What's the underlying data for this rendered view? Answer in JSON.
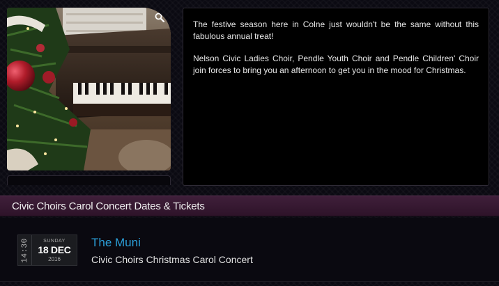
{
  "description": {
    "paragraph_1": "The festive season here in Colne just wouldn't be the same without this fabulous annual treat!",
    "paragraph_2": "Nelson Civic Ladies Choir, Pendle Youth Choir and Pendle Children' Choir join forces to bring you an afternoon to get you in the mood for Christmas."
  },
  "image": {
    "zoom_icon": "magnifier-icon"
  },
  "section": {
    "title": "Civic Choirs Carol Concert Dates & Tickets"
  },
  "event": {
    "time": "14:30",
    "weekday": "SUNDAY",
    "date": "18 DEC",
    "year": "2016",
    "venue": "The Muni",
    "title": "Civic Choirs Christmas Carol Concert"
  },
  "colors": {
    "link": "#2b9fd9",
    "header_bg": "#3f1f3a",
    "panel_bg": "#000000"
  }
}
